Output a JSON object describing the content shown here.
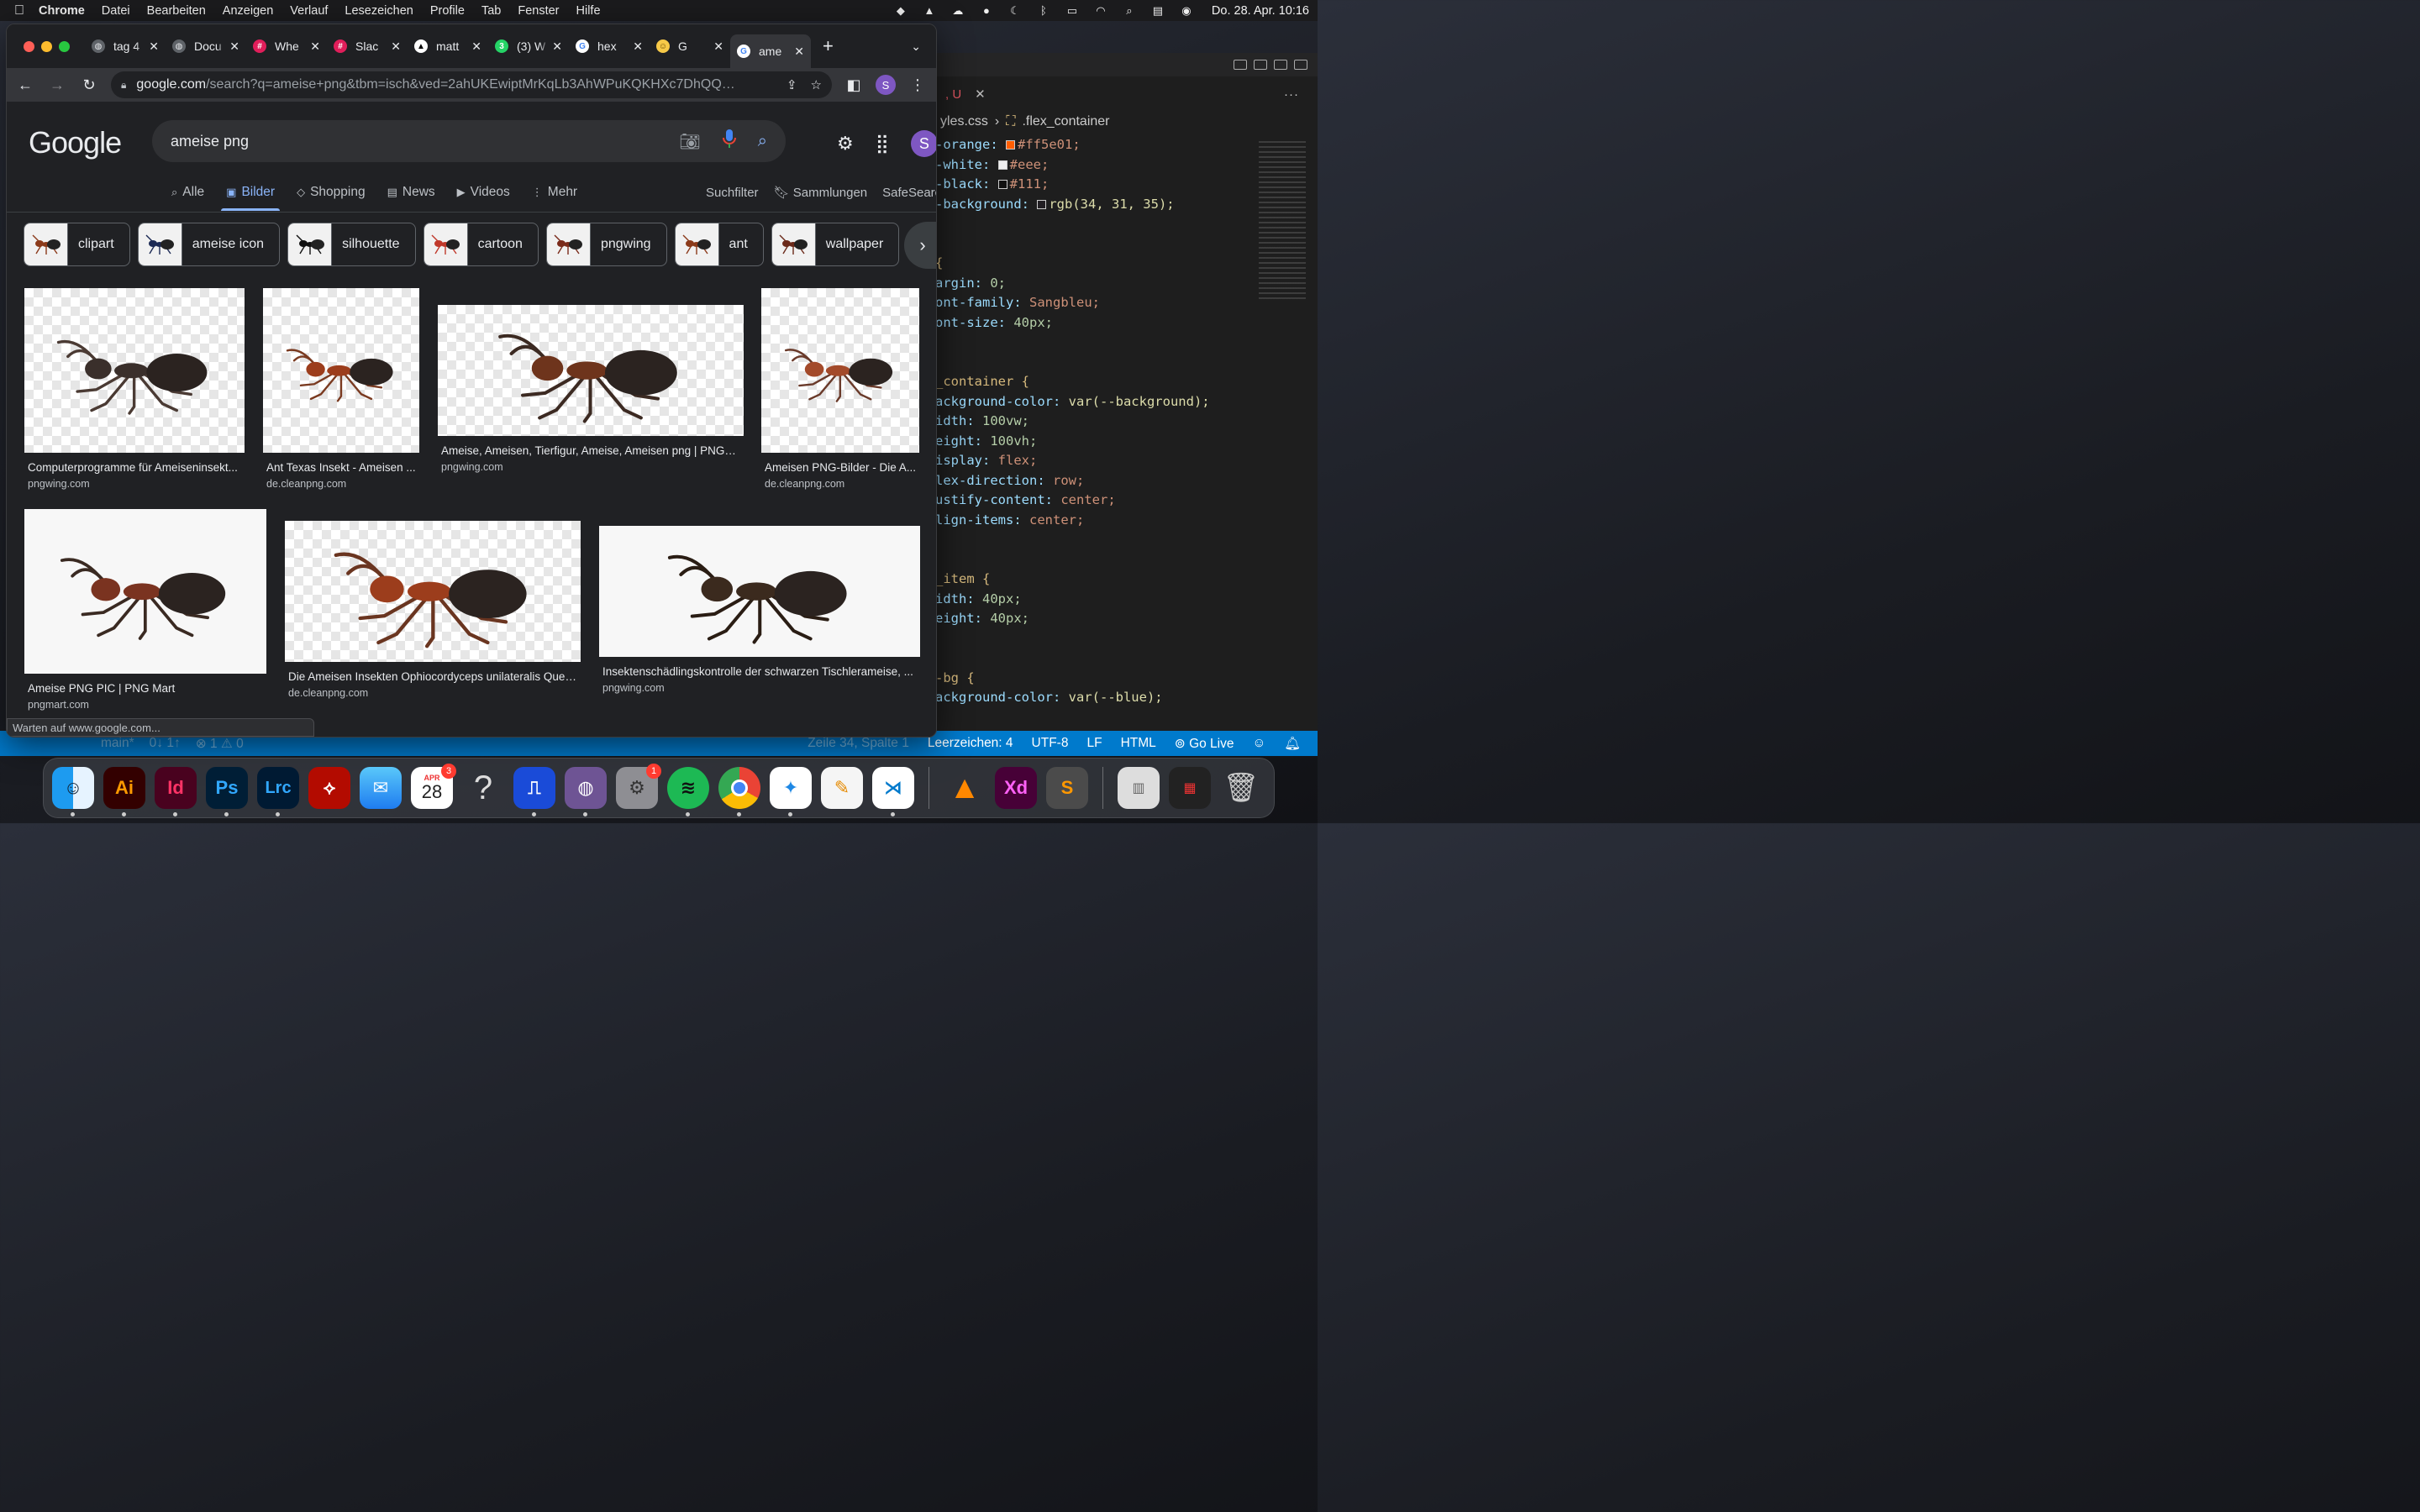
{
  "menubar": {
    "app": "Chrome",
    "items": [
      "Datei",
      "Bearbeiten",
      "Anzeigen",
      "Verlauf",
      "Lesezeichen",
      "Profile",
      "Tab",
      "Fenster",
      "Hilfe"
    ],
    "clock": "Do. 28. Apr.  10:16"
  },
  "chrome": {
    "tabs": [
      {
        "title": "tag 4",
        "fav": "globe-icon"
      },
      {
        "title": "Docu",
        "fav": "globe-icon"
      },
      {
        "title": "Whe",
        "fav": "slack-icon"
      },
      {
        "title": "Slac",
        "fav": "slack-icon"
      },
      {
        "title": "matt",
        "fav": "vercel-icon"
      },
      {
        "title": "(3) W",
        "fav": "whatsapp-icon"
      },
      {
        "title": "hex",
        "fav": "google-icon"
      },
      {
        "title": "G",
        "fav": "emoji-icon"
      },
      {
        "title": "ame",
        "fav": "google-icon"
      }
    ],
    "active_tab": 8,
    "url_host": "google.com",
    "url_path": "/search?q=ameise+png&tbm=isch&ved=2ahUKEwiptMrKqLb3AhWPuKQKHXc7DhQQ2-cCeg...",
    "profile_initial": "S",
    "status_text": "Warten auf www.google.com..."
  },
  "google": {
    "logo": "Google",
    "query": "ameise png",
    "tabs": [
      "Alle",
      "Bilder",
      "Shopping",
      "News",
      "Videos",
      "Mehr"
    ],
    "active_tab": "Bilder",
    "filters": [
      "Suchfilter",
      "Sammlungen",
      "SafeSearch"
    ],
    "chips": [
      "clipart",
      "ameise icon",
      "silhouette",
      "cartoon",
      "pngwing",
      "ant",
      "wallpaper"
    ],
    "results": [
      {
        "title": "Computerprogramme für Ameiseninsekt...",
        "source": "pngwing.com"
      },
      {
        "title": "Ant Texas Insekt - Ameisen ...",
        "source": "de.cleanpng.com"
      },
      {
        "title": "Ameise, Ameisen, Tierfigur, Ameise, Ameisen png | PNGW...",
        "source": "pngwing.com"
      },
      {
        "title": "Ameisen PNG-Bilder - Die A...",
        "source": "de.cleanpng.com"
      },
      {
        "title": "Ameise PNG PIC | PNG Mart",
        "source": "pngmart.com"
      },
      {
        "title": "Die Ameisen Insekten Ophiocordyceps unilateralis Quee...",
        "source": "de.cleanpng.com"
      },
      {
        "title": "Insektenschädlingskontrolle der schwarzen Tischlerameise, ...",
        "source": "pngwing.com"
      }
    ]
  },
  "vscode": {
    "tab_label": ", U",
    "breadcrumb_file": "yles.css",
    "breadcrumb_symbol": ".flex_container",
    "code": [
      {
        "p": "-orange:",
        "v": "#ff5e01;",
        "sw": "#ff5e01"
      },
      {
        "p": "-white:",
        "v": "#eee;",
        "sw": "#eeeeee"
      },
      {
        "p": "-black:",
        "v": "#111;",
        "sw": "#111111"
      },
      {
        "p": "-background:",
        "v": "rgb(34, 31, 35);",
        "sw": "#221f23"
      },
      {
        "p": "",
        "v": ""
      },
      {
        "p": "",
        "v": ""
      },
      {
        "p": "{",
        "v": ""
      },
      {
        "p": "argin:",
        "v": "0;"
      },
      {
        "p": "ont-family:",
        "v": "Sangbleu;"
      },
      {
        "p": "ont-size:",
        "v": "40px;"
      },
      {
        "p": "",
        "v": ""
      },
      {
        "p": "",
        "v": ""
      },
      {
        "p": "_container {",
        "v": ""
      },
      {
        "p": "ackground-color:",
        "v": "var(--background);"
      },
      {
        "p": "idth:",
        "v": "100vw;"
      },
      {
        "p": "eight:",
        "v": "100vh;"
      },
      {
        "p": "isplay:",
        "v": "flex;"
      },
      {
        "p": "lex-direction:",
        "v": "row;"
      },
      {
        "p": "ustify-content:",
        "v": "center;"
      },
      {
        "p": "lign-items:",
        "v": "center;"
      },
      {
        "p": "",
        "v": ""
      },
      {
        "p": "",
        "v": ""
      },
      {
        "p": "_item {",
        "v": ""
      },
      {
        "p": "idth:",
        "v": "40px;"
      },
      {
        "p": "eight:",
        "v": "40px;"
      },
      {
        "p": "",
        "v": ""
      },
      {
        "p": "",
        "v": ""
      },
      {
        "p": "-bg {",
        "v": ""
      },
      {
        "p": "ackground-color:",
        "v": "var(--blue);"
      }
    ],
    "status": {
      "branch": "main*",
      "sync": "0↓ 1↑",
      "problems": "⊗ 1 ⚠ 0",
      "position": "Zeile 34, Spalte 1",
      "indent": "Leerzeichen: 4",
      "encoding": "UTF-8",
      "eol": "LF",
      "language": "HTML",
      "golive": "Go Live"
    }
  },
  "dock": {
    "calendar_month": "APR",
    "calendar_day": "28",
    "calendar_badge": "3",
    "settings_badge": "1"
  }
}
